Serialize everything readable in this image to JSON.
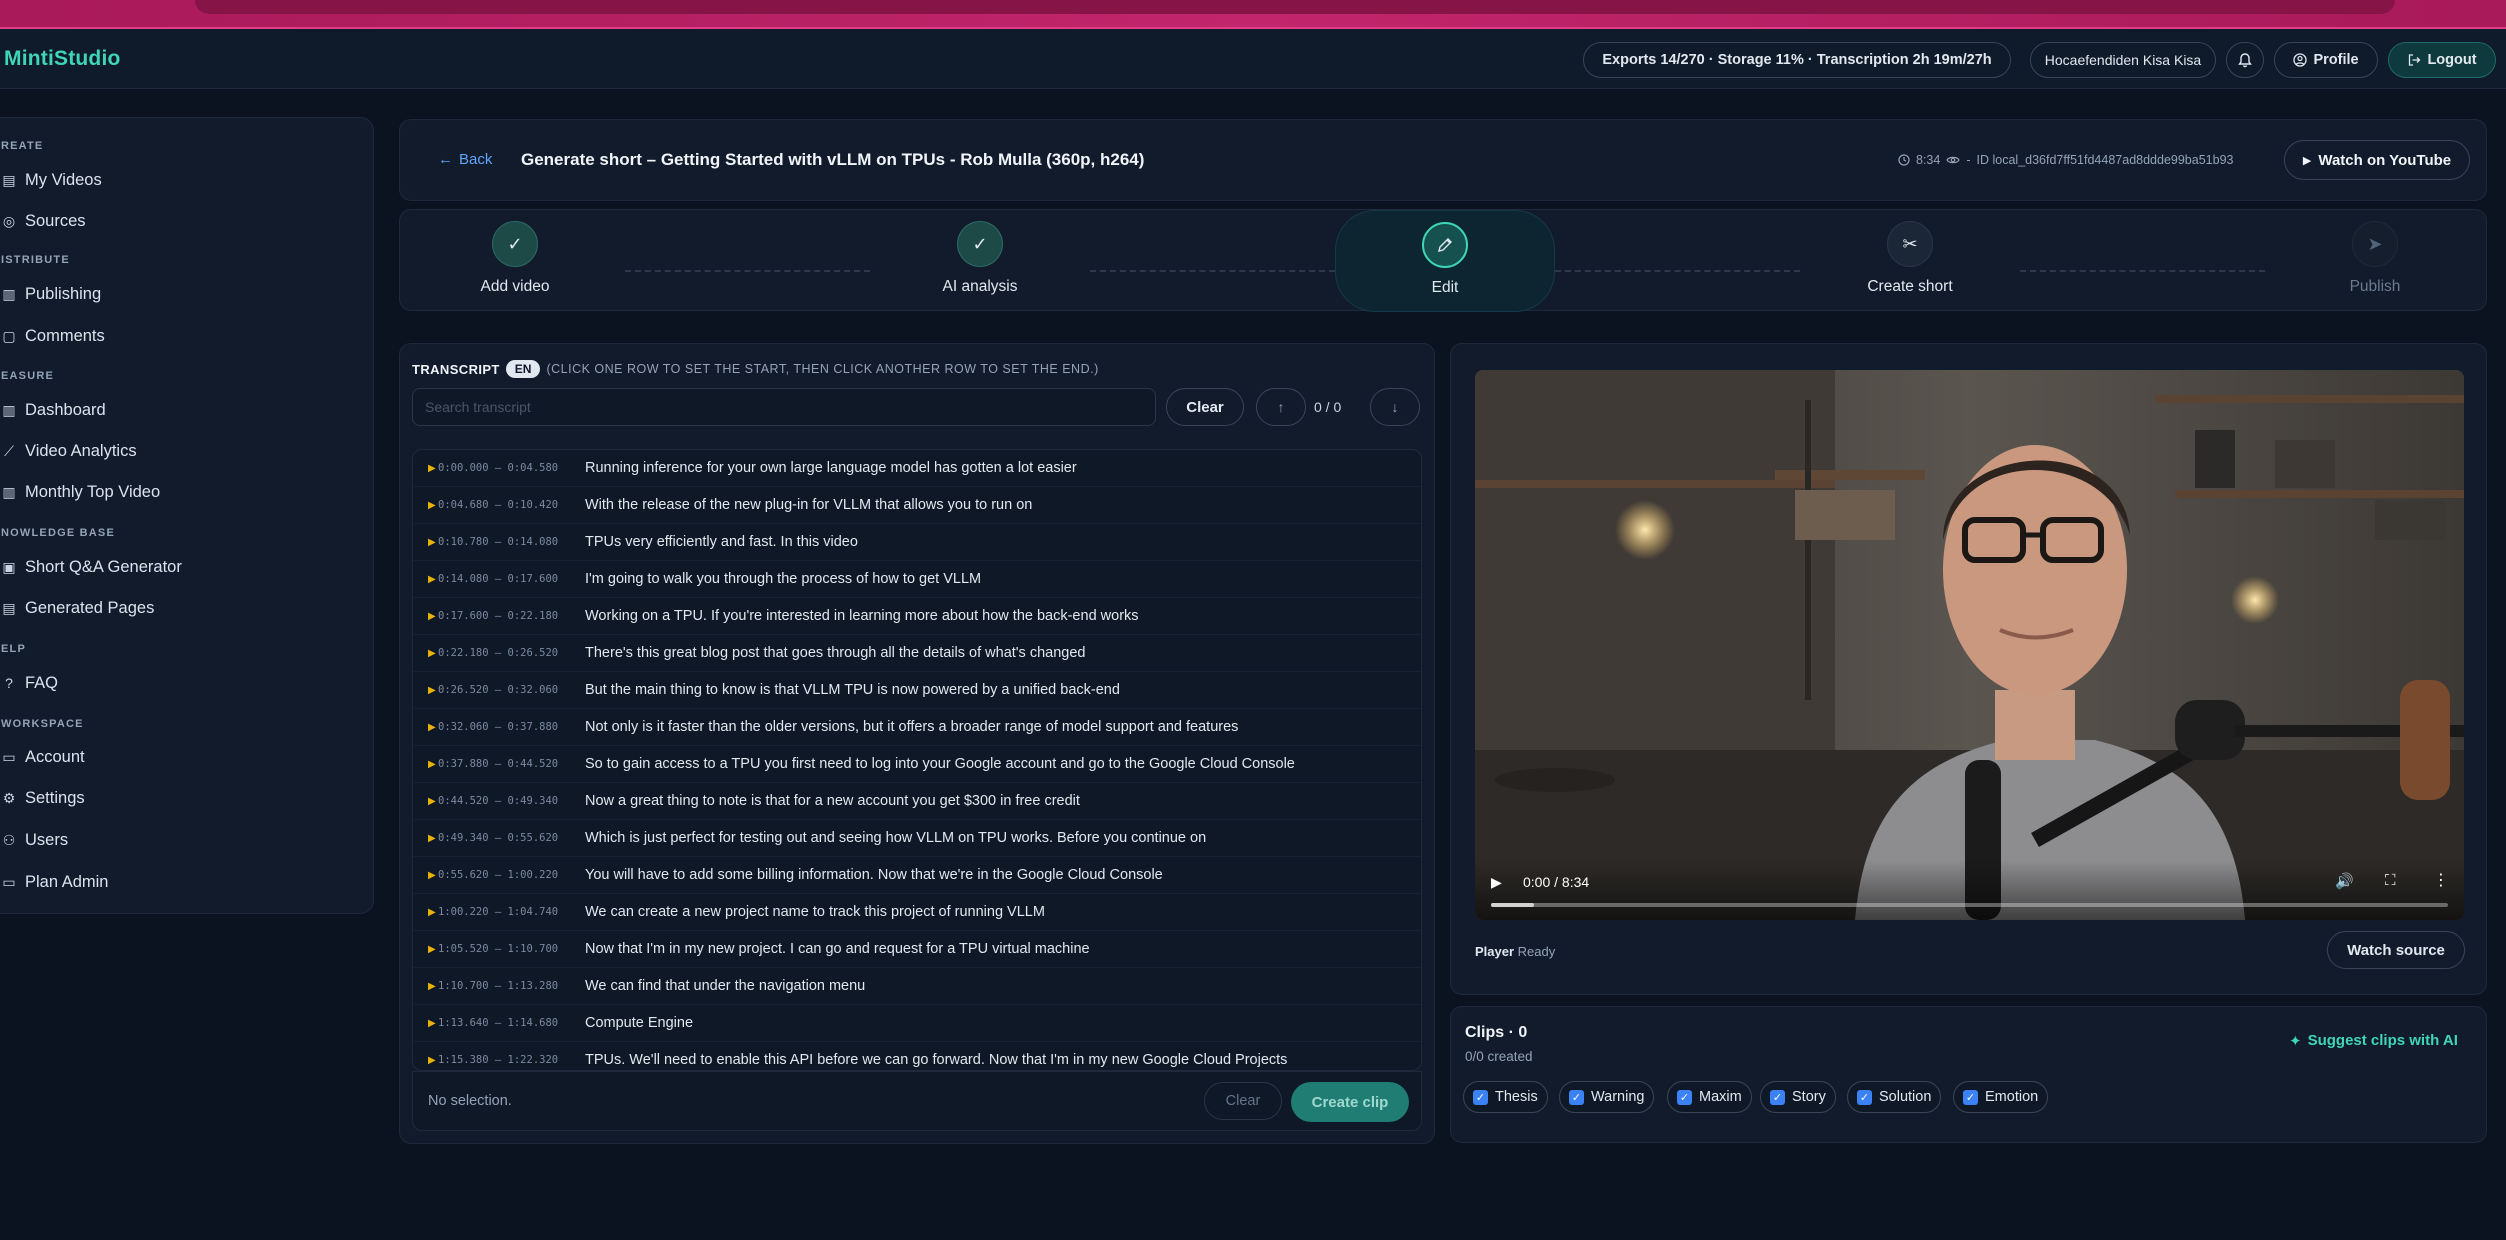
{
  "header": {
    "brand": "MintiStudio",
    "quota": "Exports 14/270 · Storage 11% · Transcription 2h 19m/27h",
    "user": "Hocaefendiden Kisa Kisa",
    "profile_label": "Profile",
    "logout_label": "Logout"
  },
  "sidebar": {
    "sections": [
      {
        "label": "REATE"
      },
      {
        "label": "ISTRIBUTE"
      },
      {
        "label": "EASURE"
      },
      {
        "label": "NOWLEDGE BASE"
      },
      {
        "label": "ELP"
      },
      {
        "label": "WORKSPACE"
      }
    ],
    "items": [
      {
        "label": "My Videos",
        "icon": "video-list-icon"
      },
      {
        "label": "Sources",
        "icon": "sources-icon"
      },
      {
        "label": "Publishing",
        "icon": "bar-chart-icon"
      },
      {
        "label": "Comments",
        "icon": "comment-icon"
      },
      {
        "label": "Dashboard",
        "icon": "dashboard-icon"
      },
      {
        "label": "Video Analytics",
        "icon": "trend-icon"
      },
      {
        "label": "Monthly Top Video",
        "icon": "bar-chart-icon"
      },
      {
        "label": "Short Q&A Generator",
        "icon": "qa-icon"
      },
      {
        "label": "Generated Pages",
        "icon": "pages-icon"
      },
      {
        "label": "FAQ",
        "icon": "help-icon"
      },
      {
        "label": "Account",
        "icon": "account-icon"
      },
      {
        "label": "Settings",
        "icon": "gear-icon"
      },
      {
        "label": "Users",
        "icon": "users-icon"
      },
      {
        "label": "Plan Admin",
        "icon": "plan-icon"
      }
    ]
  },
  "title_bar": {
    "back_label": "Back",
    "title": "Generate short – Getting Started with vLLM on TPUs - Rob Mulla (360p, h264)",
    "duration": "8:34",
    "separator": "-",
    "id_text": "ID local_d36fd7ff51fd4487ad8ddde99ba51b93",
    "youtube_label": "Watch on YouTube"
  },
  "steps": [
    {
      "label": "Add video",
      "state": "done"
    },
    {
      "label": "AI analysis",
      "state": "done"
    },
    {
      "label": "Edit",
      "state": "active"
    },
    {
      "label": "Create short",
      "state": "todo"
    },
    {
      "label": "Publish",
      "state": "disabled"
    }
  ],
  "transcript": {
    "title": "TRANSCRIPT",
    "lang": "EN",
    "hint": "(CLICK ONE ROW TO SET THE START, THEN CLICK ANOTHER ROW TO SET THE END.)",
    "search_placeholder": "Search transcript",
    "clear_label": "Clear",
    "counter": "0 / 0",
    "rows": [
      {
        "ts": "0:00.000 – 0:04.580",
        "text": "Running inference for your own large language model has gotten a lot easier"
      },
      {
        "ts": "0:04.680 – 0:10.420",
        "text": "With the release of the new plug-in for VLLM that allows you to run on"
      },
      {
        "ts": "0:10.780 – 0:14.080",
        "text": "TPUs very efficiently and fast. In this video"
      },
      {
        "ts": "0:14.080 – 0:17.600",
        "text": "I'm going to walk you through the process of how to get VLLM"
      },
      {
        "ts": "0:17.600 – 0:22.180",
        "text": "Working on a TPU. If you're interested in learning more about how the back-end works"
      },
      {
        "ts": "0:22.180 – 0:26.520",
        "text": "There's this great blog post that goes through all the details of what's changed"
      },
      {
        "ts": "0:26.520 – 0:32.060",
        "text": "But the main thing to know is that VLLM TPU is now powered by a unified back-end"
      },
      {
        "ts": "0:32.060 – 0:37.880",
        "text": "Not only is it faster than the older versions, but it offers a broader range of model support and features"
      },
      {
        "ts": "0:37.880 – 0:44.520",
        "text": "So to gain access to a TPU you first need to log into your Google account and go to the Google Cloud Console"
      },
      {
        "ts": "0:44.520 – 0:49.340",
        "text": "Now a great thing to note is that for a new account you get $300 in free credit"
      },
      {
        "ts": "0:49.340 – 0:55.620",
        "text": "Which is just perfect for testing out and seeing how VLLM on TPU works. Before you continue on"
      },
      {
        "ts": "0:55.620 – 1:00.220",
        "text": "You will have to add some billing information. Now that we're in the Google Cloud Console"
      },
      {
        "ts": "1:00.220 – 1:04.740",
        "text": "We can create a new project name to track this project of running VLLM"
      },
      {
        "ts": "1:05.520 – 1:10.700",
        "text": "Now that I'm in my new project. I can go and request for a TPU virtual machine"
      },
      {
        "ts": "1:10.700 – 1:13.280",
        "text": "We can find that under the navigation menu"
      },
      {
        "ts": "1:13.640 – 1:14.680",
        "text": "Compute Engine"
      },
      {
        "ts": "1:15.380 – 1:22.320",
        "text": "TPUs. We'll need to enable this API before we can go forward. Now that I'm in my new Google Cloud Projects"
      }
    ],
    "no_selection": "No selection.",
    "footer_clear": "Clear",
    "create_clip": "Create clip"
  },
  "player": {
    "time": "0:00 / 8:34",
    "buffered_fraction": 0.045,
    "status_label": "Player",
    "status_value": "Ready",
    "watch_source": "Watch source"
  },
  "clips": {
    "title": "Clips · 0",
    "subtitle": "0/0 created",
    "suggest_label": "Suggest clips with AI",
    "chips": [
      {
        "label": "Thesis",
        "checked": true
      },
      {
        "label": "Warning",
        "checked": true
      },
      {
        "label": "Maxim",
        "checked": true
      },
      {
        "label": "Story",
        "checked": true
      },
      {
        "label": "Solution",
        "checked": true
      },
      {
        "label": "Emotion",
        "checked": true
      }
    ]
  },
  "colors": {
    "accent": "#3ed6b5",
    "link": "#60a5fa",
    "background": "#0b1220",
    "card": "#111b2b",
    "top_strip": "#c2256b"
  }
}
